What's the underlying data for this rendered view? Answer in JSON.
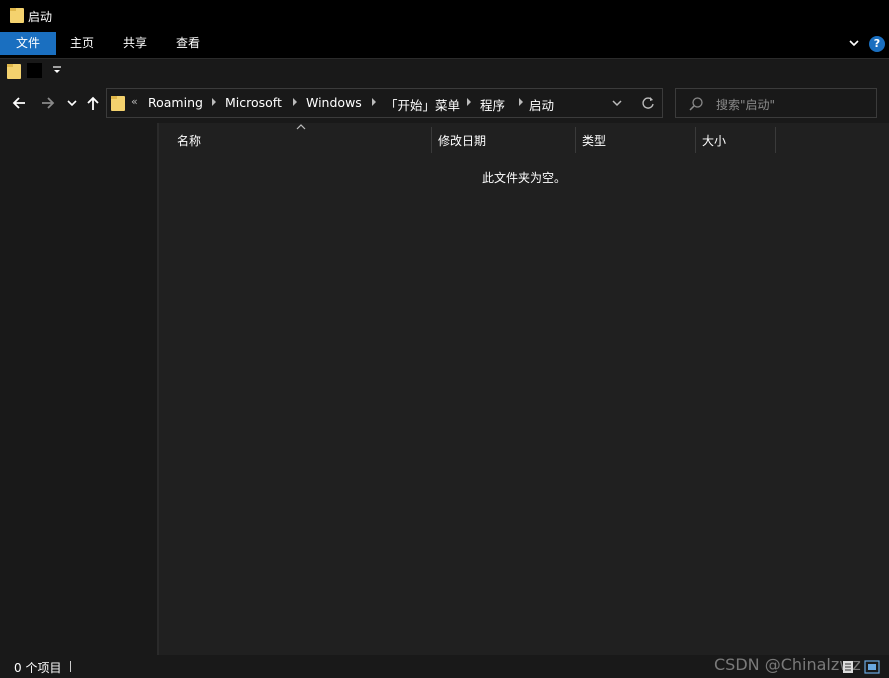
{
  "window": {
    "title": "启动"
  },
  "ribbon": {
    "tabs": [
      "文件",
      "主页",
      "共享",
      "查看"
    ],
    "help_label": "?"
  },
  "navigation": {
    "breadcrumbs": [
      "Roaming",
      "Microsoft",
      "Windows",
      "「开始」菜单",
      "程序",
      "启动"
    ],
    "overflow": "«"
  },
  "search": {
    "placeholder": "搜索\"启动\""
  },
  "file_list": {
    "columns": [
      "名称",
      "修改日期",
      "类型",
      "大小"
    ],
    "empty_message": "此文件夹为空。"
  },
  "status": {
    "item_count": "0 个项目"
  },
  "watermark": "CSDN @Chinalzwz",
  "colors": {
    "accent": "#1a6fc0",
    "folder": "#f4d26e",
    "window_bg": "#202020",
    "chrome_bg": "#191919"
  },
  "icons": [
    "folder-icon",
    "back-arrow-icon",
    "forward-arrow-icon",
    "recent-dropdown-icon",
    "up-arrow-icon",
    "chevron-right-icon",
    "refresh-icon",
    "search-icon",
    "help-icon",
    "details-view-icon",
    "large-icons-view-icon"
  ]
}
